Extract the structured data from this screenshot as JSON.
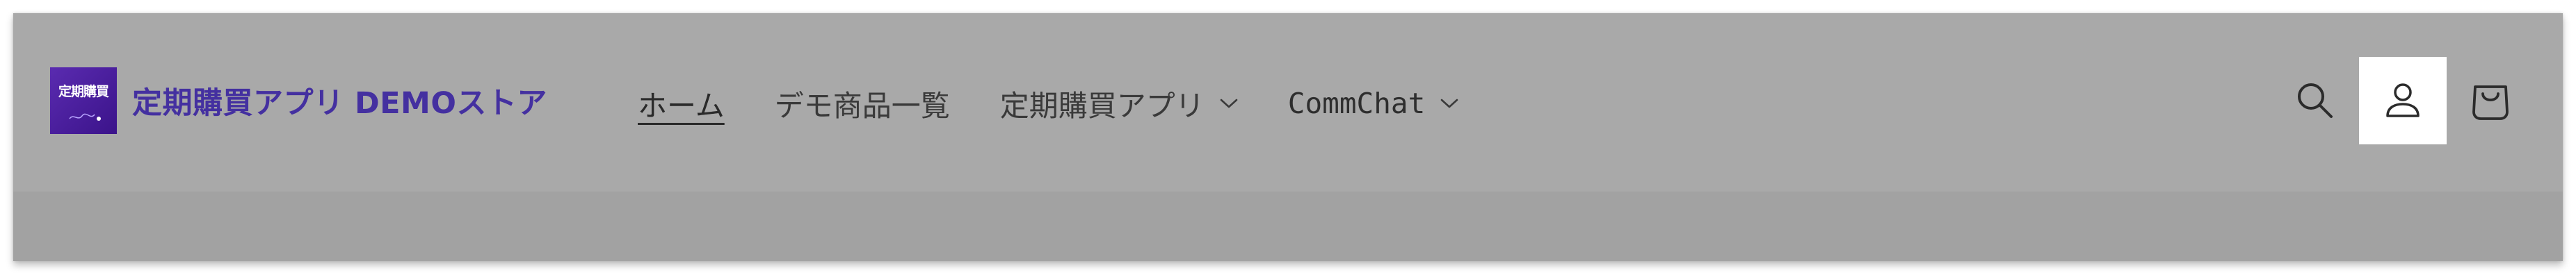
{
  "store": {
    "logo_text": "定期購買",
    "name": "定期購買アプリ DEMOストア"
  },
  "nav": {
    "items": [
      {
        "label": "ホーム",
        "active": true,
        "has_dropdown": false
      },
      {
        "label": "デモ商品一覧",
        "active": false,
        "has_dropdown": false
      },
      {
        "label": "定期購買アプリ",
        "active": false,
        "has_dropdown": true
      },
      {
        "label": "CommChat",
        "active": false,
        "has_dropdown": true
      }
    ]
  },
  "header_icons": {
    "search": "search-icon",
    "account": "account-icon",
    "cart": "cart-icon",
    "selected": "account"
  },
  "colors": {
    "header_bg": "#a9a9a9",
    "subbar_bg": "#a2a2a2",
    "brand": "#4430a0",
    "logo_bg": "#4a1f9e",
    "selected_icon_bg": "#ffffff"
  }
}
